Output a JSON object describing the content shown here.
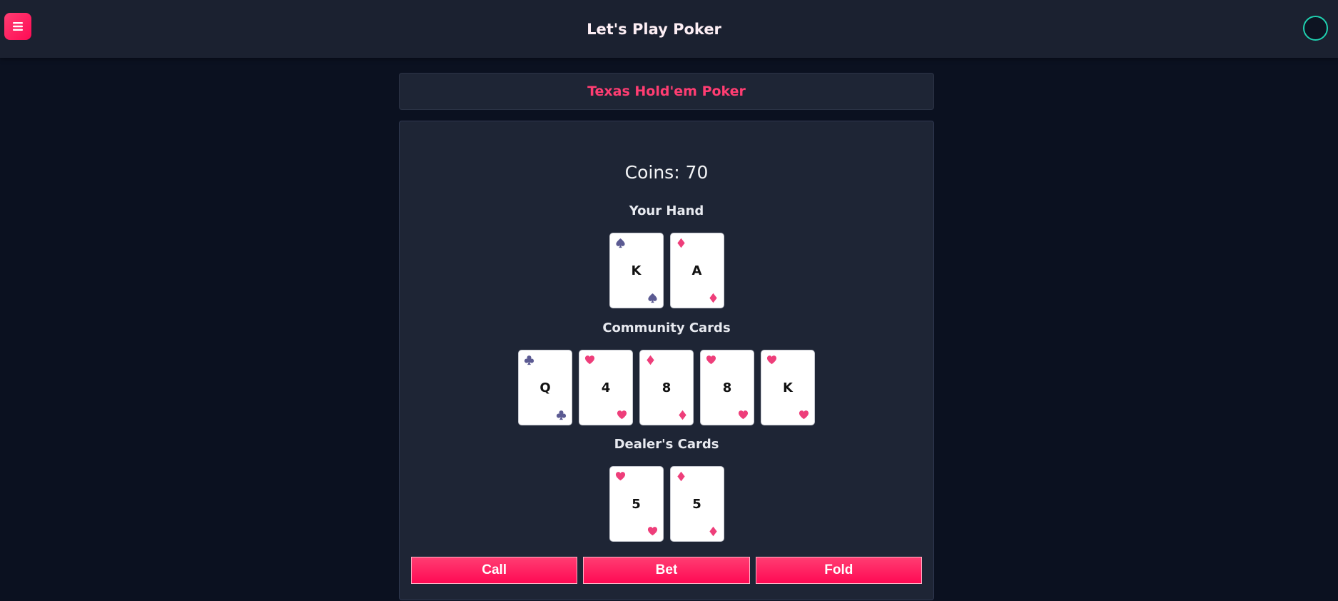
{
  "app": {
    "title": "Let's Play Poker"
  },
  "game": {
    "title": "Texas Hold'em Poker"
  },
  "coins": {
    "text": "Coins: 70"
  },
  "sections": {
    "your_hand": "Your Hand",
    "community": "Community Cards",
    "dealer": "Dealer's Cards"
  },
  "cards": {
    "your_hand": [
      {
        "rank": "K",
        "suit": "spades"
      },
      {
        "rank": "A",
        "suit": "diamonds"
      }
    ],
    "community": [
      {
        "rank": "Q",
        "suit": "clubs"
      },
      {
        "rank": "4",
        "suit": "hearts"
      },
      {
        "rank": "8",
        "suit": "diamonds"
      },
      {
        "rank": "8",
        "suit": "hearts"
      },
      {
        "rank": "K",
        "suit": "hearts"
      }
    ],
    "dealer": [
      {
        "rank": "5",
        "suit": "hearts"
      },
      {
        "rank": "5",
        "suit": "diamonds"
      }
    ]
  },
  "actions": {
    "call": "Call",
    "bet": "Bet",
    "fold": "Fold"
  },
  "icons": {
    "menu": "hamburger-menu-icon",
    "status": "status-ring-icon",
    "suits": [
      "spades-icon",
      "hearts-icon",
      "diamonds-icon",
      "clubs-icon"
    ]
  },
  "colors": {
    "accent": "#ff0a54",
    "accent_light": "#ff3d72",
    "status_ring": "#1fd1b0",
    "black_suit": "#5b5a92",
    "red_suit": "#ee3e7a",
    "background": "#0b1120",
    "panel": "#1e2535"
  }
}
